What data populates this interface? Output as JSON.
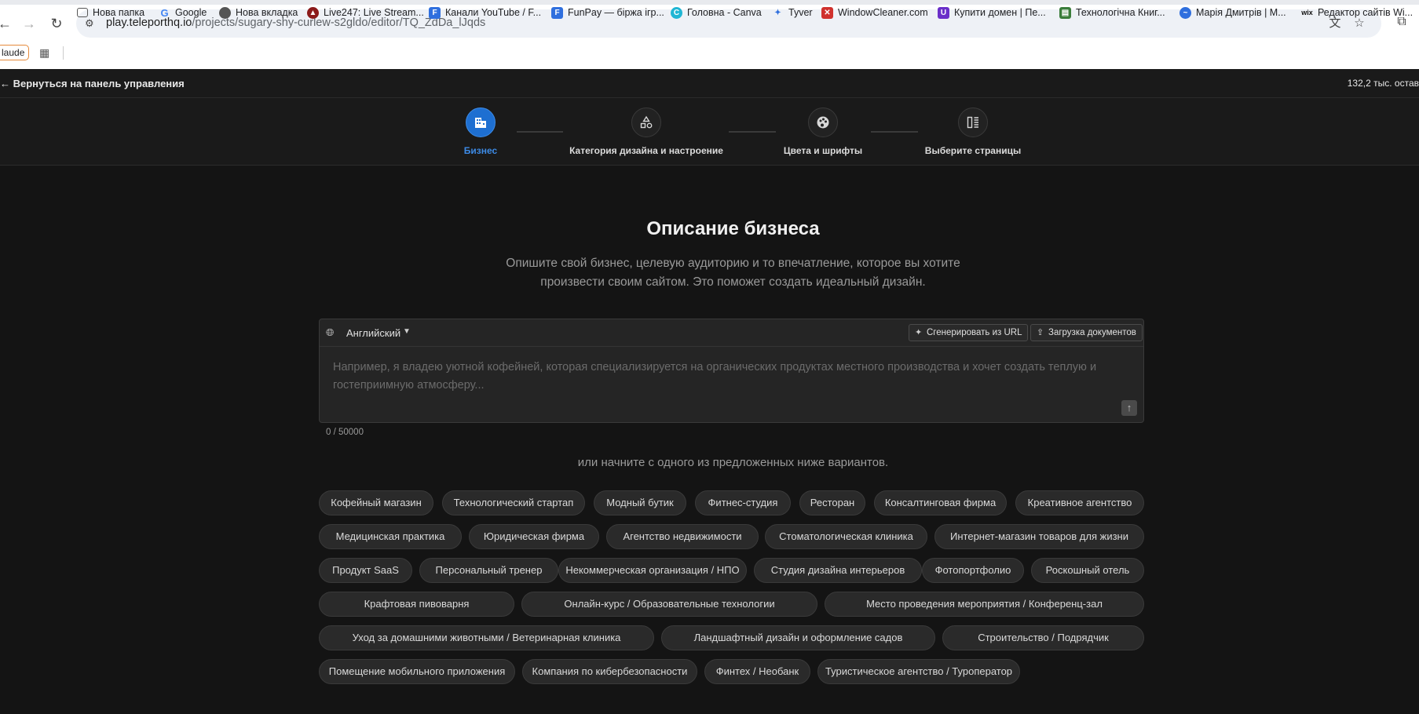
{
  "browser": {
    "url_host": "play.teleporthq.io",
    "url_path": "/projects/sugary-shy-curlew-s2gldo/editor/TQ_ZdDa_lJqds",
    "bookmark_claude": "laude",
    "bookmarks": [
      {
        "label": "Нова папка",
        "icon": "folder-icon"
      },
      {
        "label": "Google",
        "icon": "google-icon"
      },
      {
        "label": "Нова вкладка",
        "icon": "chrome-icon"
      },
      {
        "label": "Live247: Live Stream...",
        "icon": "live247-icon"
      },
      {
        "label": "Канали YouTube / F...",
        "icon": "f-icon"
      },
      {
        "label": "FunPay — біржа ігр...",
        "icon": "funpay-icon"
      },
      {
        "label": "Головна - Canva",
        "icon": "canva-icon"
      },
      {
        "label": "Tyver",
        "icon": "tyver-icon"
      },
      {
        "label": "WindowCleaner.com",
        "icon": "windowcleaner-icon"
      },
      {
        "label": "Купити домен | Пе...",
        "icon": "ua-icon"
      },
      {
        "label": "Технологічна Книг...",
        "icon": "book-icon"
      },
      {
        "label": "Марія Дмитрів | М...",
        "icon": "messenger-icon"
      },
      {
        "label": "Редактор сайтів Wi...",
        "icon": "wix-icon"
      }
    ]
  },
  "appbar": {
    "back_label": "← Вернуться на панель управления",
    "credits": "132,2 тыс. остав"
  },
  "steps": [
    {
      "label": "Бизнес",
      "icon": "building-icon",
      "active": true
    },
    {
      "label": "Категория дизайна и настроение",
      "icon": "shapes-icon",
      "active": false
    },
    {
      "label": "Цвета и шрифты",
      "icon": "palette-icon",
      "active": false
    },
    {
      "label": "Выберите страницы",
      "icon": "pages-icon",
      "active": false
    }
  ],
  "main": {
    "title": "Описание бизнеса",
    "subtitle": "Опишите свой бизнес, целевую аудиторию и то впечатление, которое вы хотите произвести своим сайтом. Это поможет создать идеальный дизайн.",
    "language": "Английский",
    "generate_url_label": "Сгенерировать из URL",
    "upload_docs_label": "Загрузка документов",
    "placeholder": "Например, я владею уютной кофейней, которая специализируется на органических продуктах местного производства и хочет создать теплую и гостеприимную атмосферу...",
    "counter": "0 / 50000",
    "or_text": "или начните с одного из предложенных ниже вариантов."
  },
  "chips": [
    "Кофейный магазин",
    "Технологический стартап",
    "Модный бутик",
    "Фитнес-студия",
    "Ресторан",
    "Консалтинговая фирма",
    "Креативное агентство",
    "Медицинская практика",
    "Юридическая фирма",
    "Агентство недвижимости",
    "Стоматологическая клиника",
    "Интернет-магазин товаров для жизни",
    "Продукт SaaS",
    "Персональный тренер",
    "Некоммерческая организация / НПО",
    "Студия дизайна интерьеров",
    "Фотопортфолио",
    "Роскошный отель",
    "Крафтовая пивоварня",
    "Онлайн-курс / Образовательные технологии",
    "Место проведения мероприятия / Конференц-зал",
    "Уход за домашними животными / Ветеринарная клиника",
    "Ландшафтный дизайн и оформление садов",
    "Строительство / Подрядчик",
    "Помещение мобильного приложения",
    "Компания по кибербезопасности",
    "Финтех / Необанк",
    "Туристическое агентство / Туроператор"
  ],
  "colors": {
    "accent": "#1e6fd1",
    "background": "#141414",
    "chip_bg": "#2a2a2a"
  }
}
